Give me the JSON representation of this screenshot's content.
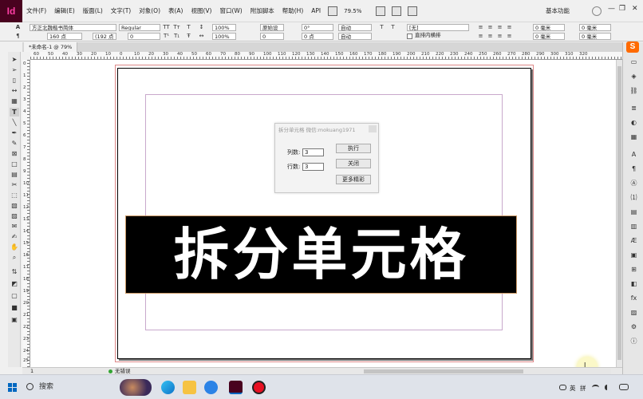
{
  "app": {
    "logo": "Id",
    "brand_color": "#49021f",
    "logo_color": "#ff3ea5"
  },
  "menu": {
    "items": [
      "文件(F)",
      "编辑(E)",
      "版面(L)",
      "文字(T)",
      "对象(O)",
      "表(A)",
      "视图(V)",
      "窗口(W)",
      "附加脚本",
      "帮助(H)",
      "API"
    ],
    "zoom": "79.5%",
    "workspace": "基本功能"
  },
  "control": {
    "font_family": "方正北魏楷书简体",
    "font_style": "Regular",
    "font_size": "160 点",
    "leading": "(192 点",
    "kerning": "原始设",
    "tracking": "0",
    "baseline_shift": "0 点",
    "skew": "0°",
    "h_scale": "100%",
    "v_scale": "100%",
    "char_style": "自动",
    "char_style2": "自动",
    "lang": "[无]",
    "option": "直排内横排",
    "indent_values": [
      "0 毫米",
      "0 毫米",
      "0 毫米",
      "0 毫米",
      "0 毫米",
      "0 毫米"
    ],
    "tt_all_caps": "TT",
    "tt_small_caps": "Tт",
    "tt_super": "T¹",
    "tt_sub": "T₁"
  },
  "document": {
    "tab": "*未命名-1 @ 79%",
    "ruler_h": [
      "60",
      "50",
      "40",
      "30",
      "20",
      "10",
      "0",
      "10",
      "20",
      "30",
      "40",
      "50",
      "60",
      "70",
      "80",
      "90",
      "100",
      "110",
      "120",
      "130",
      "140",
      "150",
      "160",
      "170",
      "180",
      "190",
      "200",
      "210",
      "220",
      "230",
      "240",
      "250",
      "260",
      "270",
      "280",
      "290",
      "300",
      "310",
      "320"
    ],
    "ruler_v": [
      "0",
      "1",
      "2",
      "3",
      "4",
      "5",
      "6",
      "7",
      "8",
      "9",
      "10",
      "11",
      "12",
      "13",
      "14",
      "15",
      "16",
      "17",
      "18",
      "19",
      "20",
      "21",
      "22",
      "23",
      "24",
      "25"
    ],
    "headline": "拆分单元格",
    "headline_color": "#ffffff",
    "frame_fill": "#000000"
  },
  "dialog": {
    "title": "拆分单元格 微信:mokuang1971",
    "columns_label": "列数:",
    "columns_value": "3",
    "rows_label": "行数:",
    "rows_value": "3",
    "run_button": "执行",
    "close_button": "关闭",
    "more_button": "更多精彩"
  },
  "status": {
    "page": "1",
    "preflight": "无错误",
    "preflight_color": "#33a534"
  },
  "taskbar": {
    "search": "搜索",
    "tray_lang": "英",
    "tray_ime": "拼"
  }
}
